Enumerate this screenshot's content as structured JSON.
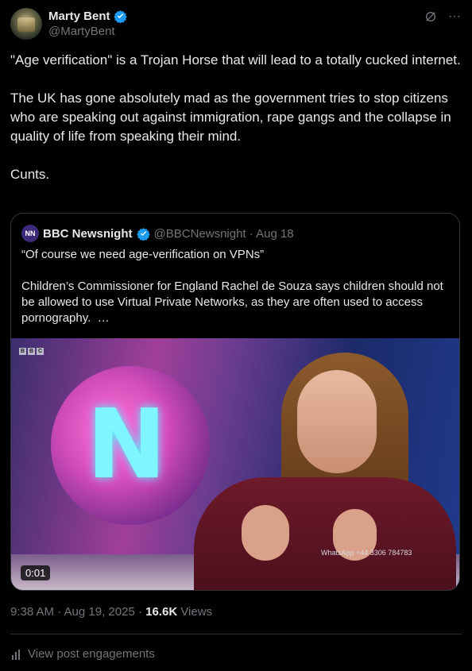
{
  "author": {
    "name": "Marty Bent",
    "handle": "@MartyBent",
    "verified_color": "#1d9bf0"
  },
  "header_icons": [
    "grok-icon",
    "more-icon"
  ],
  "post": {
    "text": "\"Age verification\" is a Trojan Horse that will lead to a totally cucked internet.\n\nThe UK has gone absolutely mad as the government tries to stop citizens who are speaking out against immigration, rape gangs and the collapse in quality of life from speaking their mind.\n\nCunts."
  },
  "quote": {
    "avatar_text": "NN",
    "name": "BBC Newsnight",
    "handle_date": "@BBCNewsnight · Aug 18",
    "text": "“Of course we need age-verification on VPNs”\n\nChildren’s Commissioner for England Rachel de Souza says children should not be allowed to use Virtual Private Networks, as they are often used to access pornography.  …",
    "media": {
      "bbc_letters": [
        "B",
        "B",
        "C"
      ],
      "watermark": "WhatsApp +44 3306 784783",
      "duration": "0:01"
    }
  },
  "meta": {
    "timestamp": "9:38 AM · Aug 19, 2025 · ",
    "views_count": "16.6K",
    "views_label": " Views"
  },
  "engagements": {
    "label": "View post engagements"
  }
}
